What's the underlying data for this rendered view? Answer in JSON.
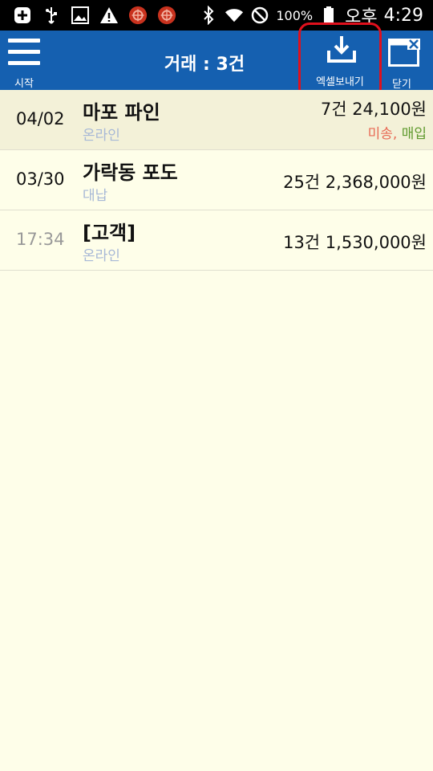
{
  "status_bar": {
    "battery": "100%",
    "ampm": "오후",
    "time": "4:29"
  },
  "appbar": {
    "menu_label": "시작",
    "title": "거래 : 3건",
    "excel_label": "엑셀보내기",
    "close_label": "닫기",
    "color": "#1560b0"
  },
  "rows": [
    {
      "date": "04/02",
      "name": "마포 파인",
      "sub": "온라인",
      "amount": "7건 24,100원",
      "status_a": "미송",
      "status_sep": ", ",
      "status_b": "매입"
    },
    {
      "date": "03/30",
      "name": "가락동 포도",
      "sub": "대납",
      "amount": "25건 2,368,000원"
    },
    {
      "date": "17:34",
      "name": "[고객]",
      "sub": "온라인",
      "amount": "13건 1,530,000원"
    }
  ]
}
